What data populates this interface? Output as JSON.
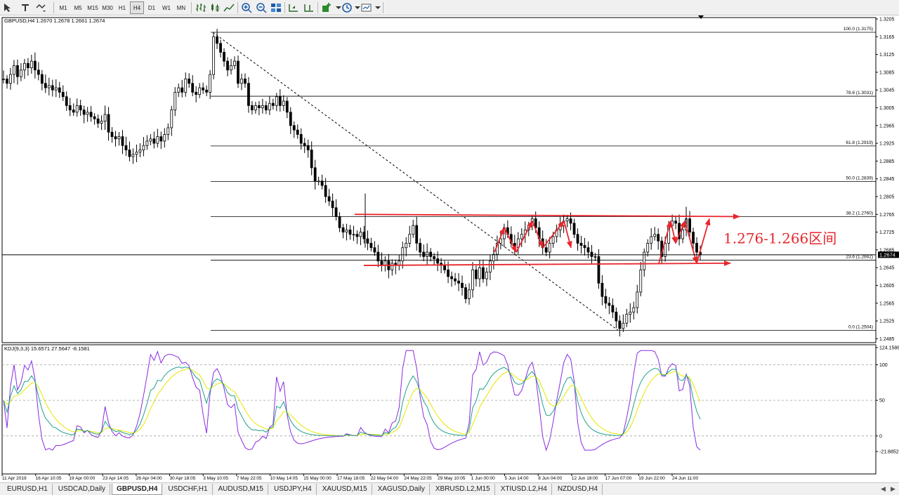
{
  "toolbar": {
    "timeframes": [
      "M1",
      "M5",
      "M15",
      "M30",
      "H1",
      "H4",
      "D1",
      "W1",
      "MN"
    ],
    "active_timeframe": "H4"
  },
  "main_chart": {
    "header": "GBPUSD,H4  1.2670 1.2678 1.2661 1.2674",
    "current_price": "1.2674",
    "annotation": "1.276-1.266区间"
  },
  "colors": {
    "candles": "#000000",
    "annotation": "#e8262c",
    "k_line": "#8a2be2",
    "d_line": "#e6e600",
    "j_line": "#1fa08c",
    "grid": "#a0a0a0"
  },
  "chart_data": [
    {
      "type": "candlestick",
      "title": "GBPUSD,H4",
      "ohlc_last": {
        "open": 1.267,
        "high": 1.2678,
        "low": 1.2661,
        "close": 1.2674
      },
      "y_ticks": [
        "1.3205",
        "1.3165",
        "1.3125",
        "1.3085",
        "1.3045",
        "1.3005",
        "1.2965",
        "1.2925",
        "1.2885",
        "1.2845",
        "1.2805",
        "1.2765",
        "1.2725",
        "1.2685",
        "1.2645",
        "1.2605",
        "1.2565",
        "1.2525",
        "1.2485"
      ],
      "x_ticks": [
        "11 Apr 2019",
        "16 Apr 10:05",
        "19 Apr 00:00",
        "23 Apr 14:05",
        "26 Apr 04:00",
        "30 Apr 18:05",
        "3 May 10:05",
        "7 May 22:05",
        "10 May 14:05",
        "15 May 00:00",
        "17 May 18:05",
        "22 May 04:00",
        "24 May 22:05",
        "29 May 10:05",
        "1 Jun 00:00",
        "5 Jun 14:00",
        "8 Jun 04:00",
        "12 Jun 18:00",
        "17 Jun 07:00",
        "19 Jun 22:00",
        "24 Jun 11:00"
      ],
      "fibonacci": [
        {
          "label": "100.0",
          "price": "1.3175"
        },
        {
          "label": "78.6",
          "price": "1.3031"
        },
        {
          "label": "61.8",
          "price": "1.2919"
        },
        {
          "label": "50.0",
          "price": "1.2839"
        },
        {
          "label": "38.2",
          "price": "1.2760"
        },
        {
          "label": "23.6",
          "price": "1.2662"
        },
        {
          "label": "0.0",
          "price": "1.2504"
        }
      ],
      "close_path": [
        [
          0,
          1.307
        ],
        [
          5,
          1.306
        ],
        [
          10,
          1.308
        ],
        [
          15,
          1.31
        ],
        [
          20,
          1.3075
        ],
        [
          25,
          1.309
        ],
        [
          30,
          1.3105
        ],
        [
          35,
          1.3095
        ],
        [
          40,
          1.311
        ],
        [
          45,
          1.309
        ],
        [
          50,
          1.308
        ],
        [
          55,
          1.306
        ],
        [
          60,
          1.305
        ],
        [
          65,
          1.3055
        ],
        [
          70,
          1.3045
        ],
        [
          75,
          1.305
        ],
        [
          80,
          1.304
        ],
        [
          85,
          1.303
        ],
        [
          90,
          1.301
        ],
        [
          95,
          1.3
        ],
        [
          100,
          1.2995
        ],
        [
          105,
          1.301
        ],
        [
          110,
          1.3
        ],
        [
          115,
          1.299
        ],
        [
          120,
          1.2995
        ],
        [
          125,
          1.2985
        ],
        [
          130,
          1.298
        ],
        [
          135,
          1.297
        ],
        [
          140,
          1.2975
        ],
        [
          145,
          1.299
        ],
        [
          150,
          1.295
        ],
        [
          155,
          1.294
        ],
        [
          160,
          1.2935
        ],
        [
          165,
          1.294
        ],
        [
          170,
          1.292
        ],
        [
          175,
          1.291
        ],
        [
          180,
          1.2895
        ],
        [
          185,
          1.29
        ],
        [
          190,
          1.2905
        ],
        [
          195,
          1.291
        ],
        [
          200,
          1.292
        ],
        [
          205,
          1.293
        ],
        [
          210,
          1.2935
        ],
        [
          215,
          1.2925
        ],
        [
          220,
          1.294
        ],
        [
          225,
          1.293
        ],
        [
          230,
          1.2945
        ],
        [
          235,
          1.296
        ],
        [
          240,
          1.3
        ],
        [
          245,
          1.304
        ],
        [
          250,
          1.305
        ],
        [
          255,
          1.304
        ],
        [
          260,
          1.307
        ],
        [
          265,
          1.306
        ],
        [
          270,
          1.304
        ],
        [
          275,
          1.3035
        ],
        [
          280,
          1.305
        ],
        [
          285,
          1.3045
        ],
        [
          290,
          1.304
        ],
        [
          295,
          1.308
        ],
        [
          300,
          1.3165
        ],
        [
          305,
          1.315
        ],
        [
          310,
          1.313
        ],
        [
          315,
          1.311
        ],
        [
          320,
          1.309
        ],
        [
          325,
          1.31
        ],
        [
          330,
          1.311
        ],
        [
          335,
          1.306
        ],
        [
          340,
          1.307
        ],
        [
          345,
          1.306
        ],
        [
          350,
          1.301
        ],
        [
          355,
          1.3
        ],
        [
          360,
          1.301
        ],
        [
          365,
          1.3005
        ],
        [
          370,
          1.301
        ],
        [
          375,
          1.3
        ],
        [
          380,
          1.3015
        ],
        [
          385,
          1.301
        ],
        [
          390,
          1.303
        ],
        [
          395,
          1.301
        ],
        [
          400,
          1.302
        ],
        [
          405,
          1.2995
        ],
        [
          410,
          1.2965
        ],
        [
          415,
          1.2955
        ],
        [
          420,
          1.2945
        ],
        [
          425,
          1.2925
        ],
        [
          430,
          1.292
        ],
        [
          435,
          1.291
        ],
        [
          440,
          1.287
        ],
        [
          445,
          1.284
        ],
        [
          450,
          1.284
        ],
        [
          455,
          1.283
        ],
        [
          460,
          1.2805
        ],
        [
          465,
          1.2795
        ],
        [
          470,
          1.278
        ],
        [
          475,
          1.276
        ],
        [
          480,
          1.2735
        ],
        [
          485,
          1.2725
        ],
        [
          490,
          1.273
        ],
        [
          495,
          1.272
        ],
        [
          500,
          1.272
        ],
        [
          505,
          1.2715
        ],
        [
          510,
          1.2725
        ],
        [
          515,
          1.271
        ],
        [
          520,
          1.27
        ],
        [
          525,
          1.269
        ],
        [
          530,
          1.268
        ],
        [
          535,
          1.266
        ],
        [
          540,
          1.265
        ],
        [
          545,
          1.266
        ],
        [
          550,
          1.264
        ],
        [
          555,
          1.2655
        ],
        [
          560,
          1.265
        ],
        [
          565,
          1.266
        ],
        [
          570,
          1.269
        ],
        [
          575,
          1.27
        ],
        [
          580,
          1.272
        ],
        [
          585,
          1.274
        ],
        [
          590,
          1.27
        ],
        [
          595,
          1.268
        ],
        [
          600,
          1.267
        ],
        [
          605,
          1.268
        ],
        [
          610,
          1.267
        ],
        [
          615,
          1.2665
        ],
        [
          620,
          1.2655
        ],
        [
          625,
          1.265
        ],
        [
          630,
          1.264
        ],
        [
          635,
          1.2625
        ],
        [
          640,
          1.262
        ],
        [
          645,
          1.2615
        ],
        [
          650,
          1.261
        ],
        [
          655,
          1.26
        ],
        [
          660,
          1.2575
        ],
        [
          665,
          1.2595
        ],
        [
          670,
          1.264
        ],
        [
          675,
          1.262
        ],
        [
          680,
          1.2645
        ],
        [
          685,
          1.262
        ],
        [
          690,
          1.2635
        ],
        [
          695,
          1.266
        ],
        [
          700,
          1.2675
        ],
        [
          705,
          1.27
        ],
        [
          710,
          1.271
        ],
        [
          715,
          1.2735
        ],
        [
          720,
          1.272
        ],
        [
          725,
          1.27
        ],
        [
          730,
          1.269
        ],
        [
          735,
          1.271
        ],
        [
          740,
          1.272
        ],
        [
          745,
          1.273
        ],
        [
          750,
          1.274
        ],
        [
          755,
          1.2755
        ],
        [
          760,
          1.2735
        ],
        [
          765,
          1.271
        ],
        [
          770,
          1.269
        ],
        [
          775,
          1.268
        ],
        [
          780,
          1.27
        ],
        [
          785,
          1.2715
        ],
        [
          790,
          1.273
        ],
        [
          795,
          1.274
        ],
        [
          800,
          1.275
        ],
        [
          805,
          1.2755
        ],
        [
          810,
          1.2745
        ],
        [
          815,
          1.272
        ],
        [
          820,
          1.27
        ],
        [
          825,
          1.2695
        ],
        [
          830,
          1.269
        ],
        [
          835,
          1.268
        ],
        [
          840,
          1.267
        ],
        [
          845,
          1.267
        ],
        [
          850,
          1.261
        ],
        [
          855,
          1.258
        ],
        [
          860,
          1.2565
        ],
        [
          865,
          1.256
        ],
        [
          870,
          1.2545
        ],
        [
          875,
          1.2525
        ],
        [
          880,
          1.2508
        ],
        [
          885,
          1.252
        ],
        [
          890,
          1.254
        ],
        [
          895,
          1.2545
        ],
        [
          900,
          1.2555
        ],
        [
          905,
          1.259
        ],
        [
          910,
          1.264
        ],
        [
          915,
          1.268
        ],
        [
          920,
          1.27
        ],
        [
          925,
          1.2715
        ],
        [
          930,
          1.272
        ],
        [
          935,
          1.2705
        ],
        [
          940,
          1.267
        ],
        [
          945,
          1.27
        ],
        [
          950,
          1.274
        ],
        [
          955,
          1.275
        ],
        [
          960,
          1.2745
        ],
        [
          965,
          1.271
        ],
        [
          970,
          1.273
        ],
        [
          975,
          1.2755
        ],
        [
          980,
          1.2725
        ],
        [
          985,
          1.27
        ],
        [
          990,
          1.268
        ],
        [
          995,
          1.2674
        ]
      ]
    },
    {
      "type": "line",
      "title": "KDJ(9,3,3)",
      "header": "KDJ(9,3,3) 15.6571 27.5647 -8.1581",
      "y_ticks": [
        "124.1586",
        "100",
        "50",
        "0",
        "-21.8852"
      ],
      "series": [
        {
          "name": "K",
          "values": [
            27.5647
          ]
        },
        {
          "name": "D",
          "values": [
            15.6571
          ]
        },
        {
          "name": "J",
          "values": [
            -8.1581
          ]
        }
      ]
    }
  ],
  "tabs": [
    {
      "label": "EURUSD,H1"
    },
    {
      "label": "USDCAD,Daily"
    },
    {
      "label": "GBPUSD,H4"
    },
    {
      "label": "USDCHF,H1"
    },
    {
      "label": "AUDUSD,M15"
    },
    {
      "label": "USDJPY,H4"
    },
    {
      "label": "XAUUSD,M15"
    },
    {
      "label": "XAGUSD,Daily"
    },
    {
      "label": "XBRUSD.L2,M15"
    },
    {
      "label": "XTIUSD.L2,H4"
    },
    {
      "label": "NZDUSD,H4"
    }
  ],
  "active_tab": "GBPUSD,H4"
}
